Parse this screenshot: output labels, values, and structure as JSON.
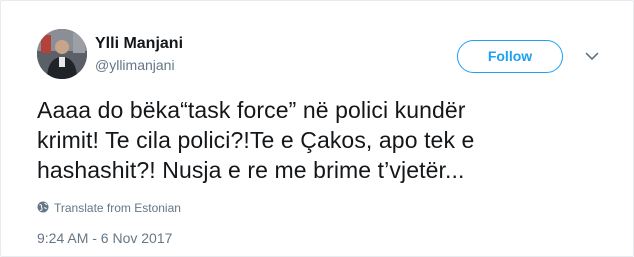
{
  "user": {
    "display_name": "Ylli Manjani",
    "handle": "@yllimanjani",
    "avatar_icon": "user-avatar-photo"
  },
  "actions": {
    "follow_label": "Follow",
    "menu_icon": "chevron-down-icon"
  },
  "tweet": {
    "line1": "Aaaa do bëka“task force” në polici kundër",
    "line2": "krimit! Te cila polici?!Te e Çakos, apo tek e",
    "line3": "hashashit?! Nusja e re me brime t’vjetër..."
  },
  "translate": {
    "label": "Translate from Estonian",
    "icon": "globe-icon"
  },
  "meta": {
    "timestamp": "9:24 AM - 6 Nov 2017"
  },
  "colors": {
    "accent": "#1da1f2",
    "text": "#14171a",
    "muted": "#657786",
    "border": "#e6ecf0"
  }
}
